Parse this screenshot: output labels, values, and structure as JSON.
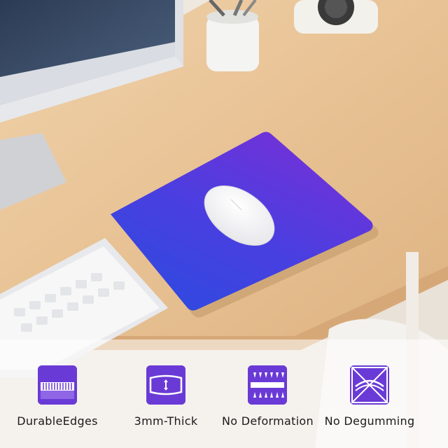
{
  "features": [
    {
      "label": "DurableEdges",
      "icon": "stitched-edge-icon"
    },
    {
      "label": "3mm-Thick",
      "icon": "thickness-icon"
    },
    {
      "label": "No Deformation",
      "icon": "no-deformation-icon"
    },
    {
      "label": "No Degumming",
      "icon": "no-degumming-icon"
    }
  ],
  "colors": {
    "accent": "#6a3ad6",
    "pad_top": "#7b2fd6",
    "pad_bottom": "#2f4ae0",
    "desk": "#e7c39a"
  }
}
